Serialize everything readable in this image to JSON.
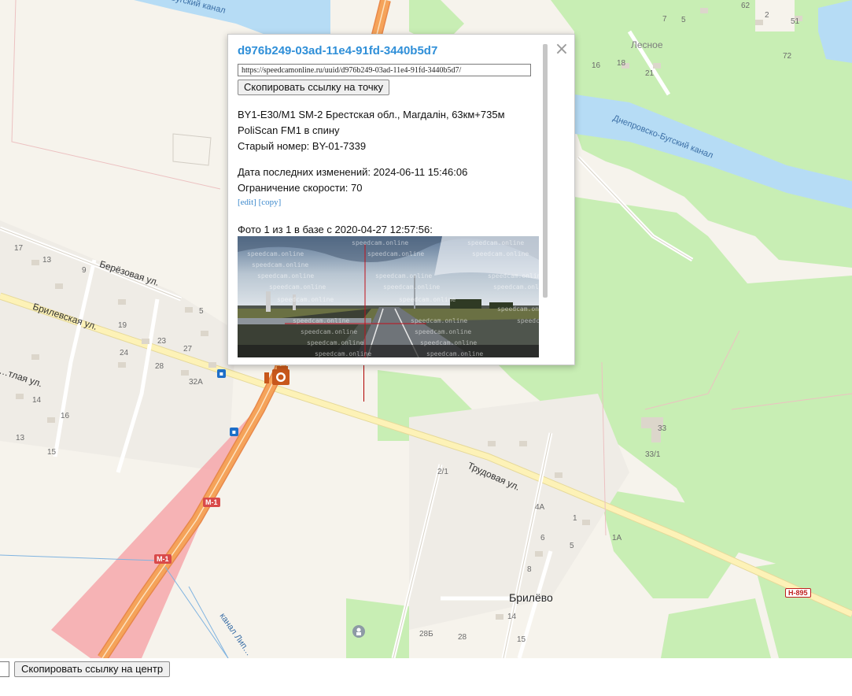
{
  "map": {
    "water_labels": {
      "canal_top": "…Бугский канал",
      "dnepro_bug": "Днепровско-Бугский канал",
      "canal_lip": "канал Лип…"
    },
    "street_labels": {
      "berezovaya": "Берёзовая ул.",
      "brilevskaya": "Брилевская ул.",
      "svetlaya": "…тлая ул.",
      "trudovaya": "Трудовая ул."
    },
    "place_labels": {
      "lesnoe": "Лесное",
      "brilevo": "Брилёво"
    },
    "road_shields": [
      "М-1",
      "М-1",
      "Н-895"
    ],
    "house_numbers": [
      "62",
      "2",
      "7",
      "5",
      "51",
      "72",
      "16",
      "18",
      "21",
      "17",
      "13",
      "9",
      "5",
      "19",
      "23",
      "27",
      "24",
      "28",
      "32А",
      "14",
      "16",
      "13",
      "15",
      "33",
      "33/1",
      "2/1",
      "4А",
      "1",
      "6",
      "5",
      "1А",
      "8",
      "14",
      "28Б",
      "28",
      "15"
    ]
  },
  "popup": {
    "uuid": "d976b249-03ad-11e4-91fd-3440b5d7",
    "url": "https://speedcamonline.ru/uuid/d976b249-03ad-11e4-91fd-3440b5d7/",
    "copy_point_label": "Скопировать ссылку на точку",
    "close_icon": "×",
    "line1": "BY1-E30/M1 SM-2 Брестская обл., Магдалін, 63км+735м",
    "line2": "PoliScan FM1 в спину",
    "line3": "Старый номер: BY-01-7339",
    "last_changed": "Дата последних изменений: 2024-06-11 15:46:06",
    "speed_limit": "Ограничение скорости: 70",
    "edit_link": "[edit]",
    "copy_link": "[copy]",
    "photo_caption": "Фото 1 из 1 в базе с 2020-04-27 12:57:56:",
    "watermark": "speedcam.online"
  },
  "bottom": {
    "copy_center_label": "Скопировать ссылку на центр"
  },
  "colors": {
    "water": "#b6dcf5",
    "forest": "#c8eeb4",
    "road_main": "#f5a35a",
    "road_secondary": "#fdf2b7",
    "camera": "#c8581c",
    "camera_sector": "#f6a3a8"
  }
}
